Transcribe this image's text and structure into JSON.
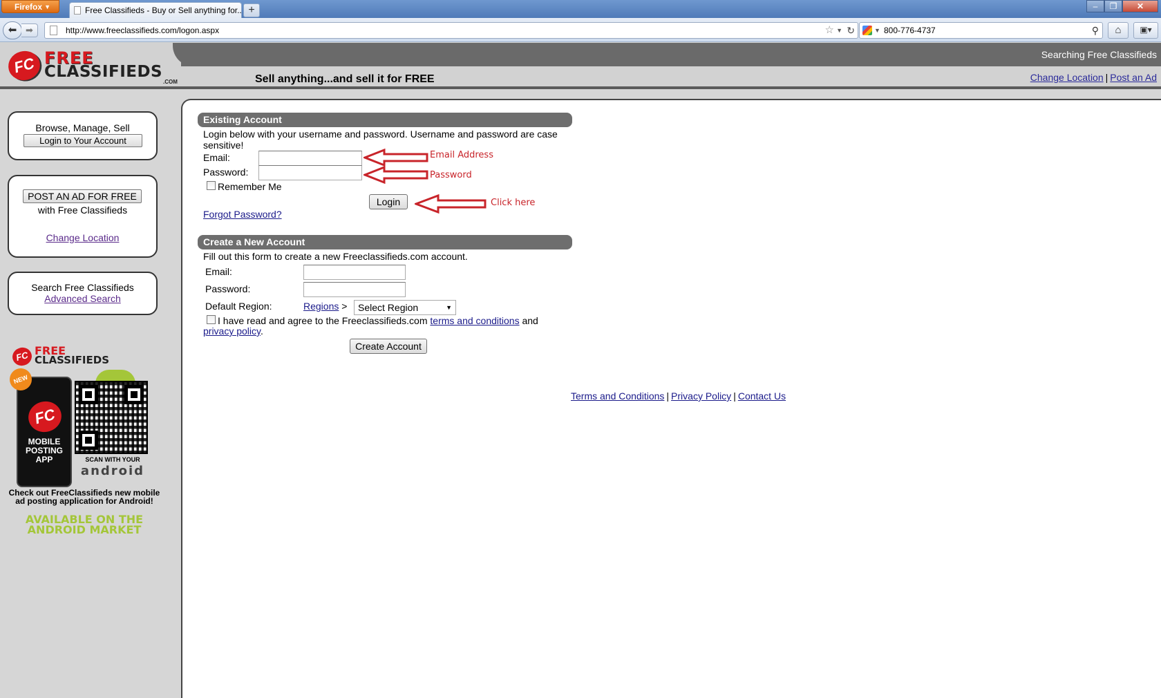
{
  "browser": {
    "menu_button": "Firefox",
    "tab_title": "Free Classifieds - Buy or Sell anything for...",
    "new_tab": "+",
    "url": "http://www.freeclassifieds.com/logon.aspx",
    "search_value": "800-776-4737"
  },
  "header": {
    "logo_fc": "FC",
    "logo_free": "FREE",
    "logo_classifieds": "CLASSIFIEDS",
    "logo_com": ".COM",
    "tagline": "Sell anything...and sell it for FREE",
    "searching": "Searching Free Classifieds",
    "change_location": "Change Location",
    "separator": "|",
    "post_ad": "Post an Ad"
  },
  "sidebar": {
    "account_text": "Browse, Manage, Sell",
    "account_button": "Login to Your Account",
    "post_button": "POST AN AD FOR FREE",
    "post_sub": "with Free Classifieds",
    "change_location": "Change Location",
    "search_text": "Search Free Classifieds",
    "advanced_search": "Advanced Search"
  },
  "promo": {
    "logo_fc": "FC",
    "logo_free": "FREE",
    "logo_classifieds": "CLASSIFIEDS",
    "new_badge": "NEW",
    "phone_text": "MOBILE POSTING APP",
    "scan_text": "SCAN WITH YOUR",
    "android_text": "android",
    "check_text": "Check out FreeClassifieds new mobile ad posting application for Android!",
    "available_text": "AVAILABLE ON THE ANDROID MARKET"
  },
  "existing": {
    "heading": "Existing Account",
    "intro": "Login below with your username and password. Username and password are case",
    "intro2": "sensitive!",
    "email_label": "Email:",
    "email_value": "",
    "password_label": "Password:",
    "password_value": "",
    "remember_label": "Remember Me",
    "login_button": "Login",
    "forgot": "Forgot Password?"
  },
  "annotations": {
    "email": "Email Address",
    "password": "Password",
    "click": "Click here",
    "arrow_color": "#c8242a"
  },
  "create": {
    "heading": "Create a New Account",
    "intro": "Fill out this form to create a new Freeclassifieds.com account.",
    "email_label": "Email:",
    "password_label": "Password:",
    "region_label": "Default Region:",
    "regions_link": "Regions",
    "regions_sep": ">",
    "select_value": "Select Region",
    "agree_text": "I have read and agree to the Freeclassifieds.com",
    "terms_link": "terms and conditions",
    "and_text": "and",
    "privacy_link": "privacy policy",
    "period": ".",
    "create_button": "Create Account"
  },
  "footer": {
    "terms": "Terms and Conditions",
    "privacy": "Privacy Policy",
    "contact": "Contact Us",
    "separator": "|"
  }
}
